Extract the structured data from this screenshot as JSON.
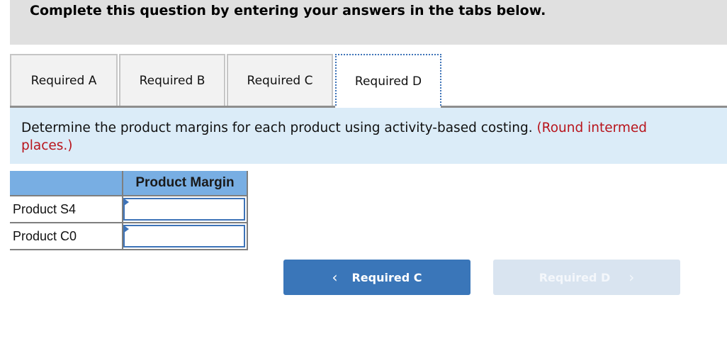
{
  "header": {
    "instruction": "Complete this question by entering your answers in the tabs below."
  },
  "tabs": [
    {
      "label": "Required A",
      "active": false
    },
    {
      "label": "Required B",
      "active": false
    },
    {
      "label": "Required C",
      "active": false
    },
    {
      "label": "Required D",
      "active": true
    }
  ],
  "question": {
    "text": "Determine the product margins for each product using activity-based costing.",
    "note": "(Round intermed",
    "note_continued": "places.)"
  },
  "table": {
    "columns": [
      "",
      "Product Margin"
    ],
    "rows": [
      {
        "label": "Product S4",
        "value": ""
      },
      {
        "label": "Product C0",
        "value": ""
      }
    ]
  },
  "navigation": {
    "prev_label": "Required C",
    "next_label": "Required D",
    "prev_icon": "chevron-left-icon",
    "next_icon": "chevron-right-icon"
  },
  "colors": {
    "accent": "#3a76b9",
    "note_red": "#b8141c",
    "instruction_bg": "#dbecf8",
    "table_header_bg": "#78aee3"
  }
}
